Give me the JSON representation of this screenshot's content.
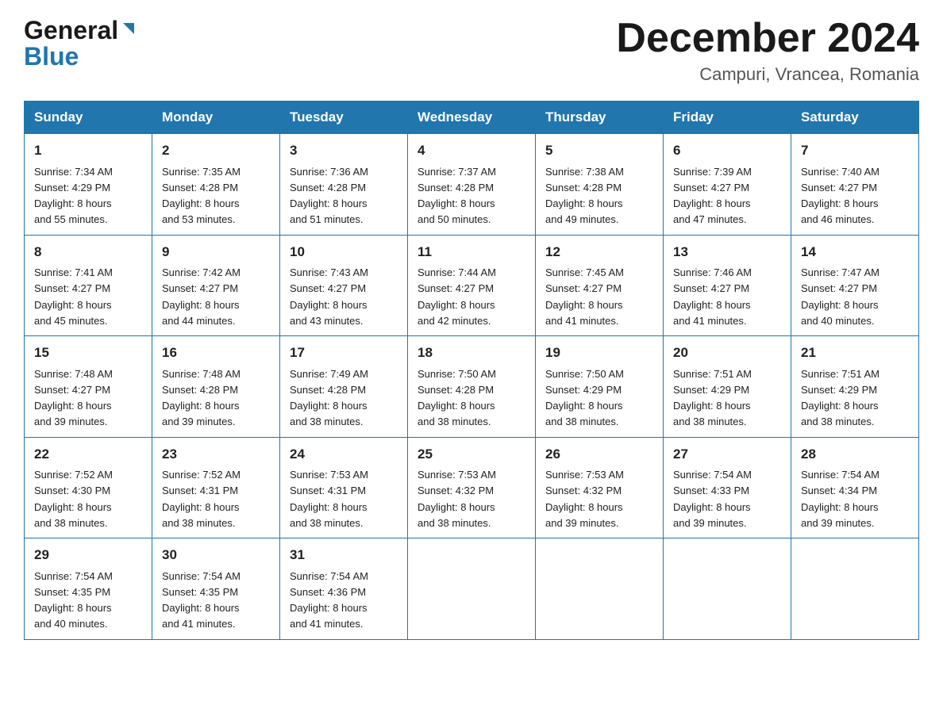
{
  "header": {
    "logo_general": "General",
    "logo_blue": "Blue",
    "month_title": "December 2024",
    "location": "Campuri, Vrancea, Romania"
  },
  "days_of_week": [
    "Sunday",
    "Monday",
    "Tuesday",
    "Wednesday",
    "Thursday",
    "Friday",
    "Saturday"
  ],
  "weeks": [
    [
      {
        "day": "1",
        "sunrise": "7:34 AM",
        "sunset": "4:29 PM",
        "daylight": "8 hours and 55 minutes."
      },
      {
        "day": "2",
        "sunrise": "7:35 AM",
        "sunset": "4:28 PM",
        "daylight": "8 hours and 53 minutes."
      },
      {
        "day": "3",
        "sunrise": "7:36 AM",
        "sunset": "4:28 PM",
        "daylight": "8 hours and 51 minutes."
      },
      {
        "day": "4",
        "sunrise": "7:37 AM",
        "sunset": "4:28 PM",
        "daylight": "8 hours and 50 minutes."
      },
      {
        "day": "5",
        "sunrise": "7:38 AM",
        "sunset": "4:28 PM",
        "daylight": "8 hours and 49 minutes."
      },
      {
        "day": "6",
        "sunrise": "7:39 AM",
        "sunset": "4:27 PM",
        "daylight": "8 hours and 47 minutes."
      },
      {
        "day": "7",
        "sunrise": "7:40 AM",
        "sunset": "4:27 PM",
        "daylight": "8 hours and 46 minutes."
      }
    ],
    [
      {
        "day": "8",
        "sunrise": "7:41 AM",
        "sunset": "4:27 PM",
        "daylight": "8 hours and 45 minutes."
      },
      {
        "day": "9",
        "sunrise": "7:42 AM",
        "sunset": "4:27 PM",
        "daylight": "8 hours and 44 minutes."
      },
      {
        "day": "10",
        "sunrise": "7:43 AM",
        "sunset": "4:27 PM",
        "daylight": "8 hours and 43 minutes."
      },
      {
        "day": "11",
        "sunrise": "7:44 AM",
        "sunset": "4:27 PM",
        "daylight": "8 hours and 42 minutes."
      },
      {
        "day": "12",
        "sunrise": "7:45 AM",
        "sunset": "4:27 PM",
        "daylight": "8 hours and 41 minutes."
      },
      {
        "day": "13",
        "sunrise": "7:46 AM",
        "sunset": "4:27 PM",
        "daylight": "8 hours and 41 minutes."
      },
      {
        "day": "14",
        "sunrise": "7:47 AM",
        "sunset": "4:27 PM",
        "daylight": "8 hours and 40 minutes."
      }
    ],
    [
      {
        "day": "15",
        "sunrise": "7:48 AM",
        "sunset": "4:27 PM",
        "daylight": "8 hours and 39 minutes."
      },
      {
        "day": "16",
        "sunrise": "7:48 AM",
        "sunset": "4:28 PM",
        "daylight": "8 hours and 39 minutes."
      },
      {
        "day": "17",
        "sunrise": "7:49 AM",
        "sunset": "4:28 PM",
        "daylight": "8 hours and 38 minutes."
      },
      {
        "day": "18",
        "sunrise": "7:50 AM",
        "sunset": "4:28 PM",
        "daylight": "8 hours and 38 minutes."
      },
      {
        "day": "19",
        "sunrise": "7:50 AM",
        "sunset": "4:29 PM",
        "daylight": "8 hours and 38 minutes."
      },
      {
        "day": "20",
        "sunrise": "7:51 AM",
        "sunset": "4:29 PM",
        "daylight": "8 hours and 38 minutes."
      },
      {
        "day": "21",
        "sunrise": "7:51 AM",
        "sunset": "4:29 PM",
        "daylight": "8 hours and 38 minutes."
      }
    ],
    [
      {
        "day": "22",
        "sunrise": "7:52 AM",
        "sunset": "4:30 PM",
        "daylight": "8 hours and 38 minutes."
      },
      {
        "day": "23",
        "sunrise": "7:52 AM",
        "sunset": "4:31 PM",
        "daylight": "8 hours and 38 minutes."
      },
      {
        "day": "24",
        "sunrise": "7:53 AM",
        "sunset": "4:31 PM",
        "daylight": "8 hours and 38 minutes."
      },
      {
        "day": "25",
        "sunrise": "7:53 AM",
        "sunset": "4:32 PM",
        "daylight": "8 hours and 38 minutes."
      },
      {
        "day": "26",
        "sunrise": "7:53 AM",
        "sunset": "4:32 PM",
        "daylight": "8 hours and 39 minutes."
      },
      {
        "day": "27",
        "sunrise": "7:54 AM",
        "sunset": "4:33 PM",
        "daylight": "8 hours and 39 minutes."
      },
      {
        "day": "28",
        "sunrise": "7:54 AM",
        "sunset": "4:34 PM",
        "daylight": "8 hours and 39 minutes."
      }
    ],
    [
      {
        "day": "29",
        "sunrise": "7:54 AM",
        "sunset": "4:35 PM",
        "daylight": "8 hours and 40 minutes."
      },
      {
        "day": "30",
        "sunrise": "7:54 AM",
        "sunset": "4:35 PM",
        "daylight": "8 hours and 41 minutes."
      },
      {
        "day": "31",
        "sunrise": "7:54 AM",
        "sunset": "4:36 PM",
        "daylight": "8 hours and 41 minutes."
      },
      null,
      null,
      null,
      null
    ]
  ],
  "labels": {
    "sunrise": "Sunrise:",
    "sunset": "Sunset:",
    "daylight": "Daylight:"
  }
}
